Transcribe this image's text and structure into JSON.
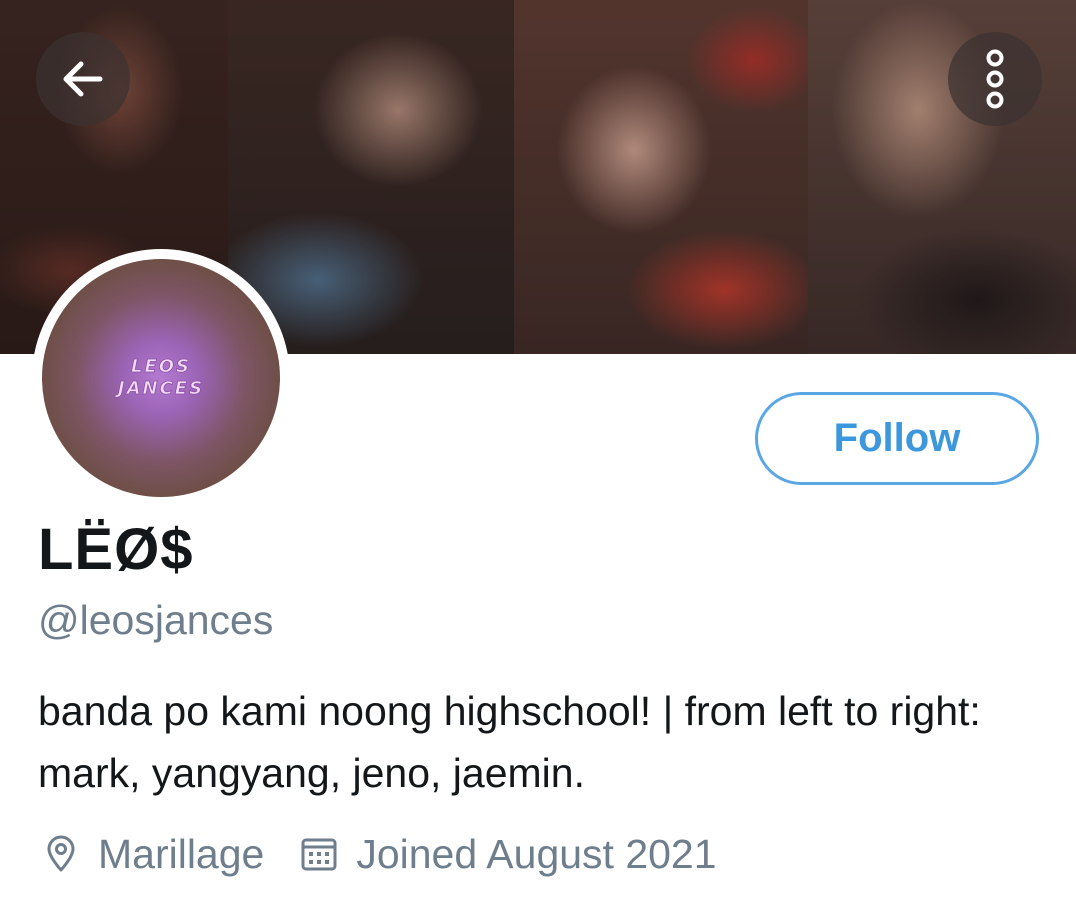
{
  "header": {
    "back_icon": "arrow-left-icon",
    "more_icon": "more-vertical-icon"
  },
  "profile": {
    "avatar_text_line1": "LEOS",
    "avatar_text_line2": "JANCES",
    "display_name": "LËØ$",
    "handle": "@leosjances",
    "bio": "banda po kami noong highschool! | from left to right: mark, yangyang, jeno, jaemin.",
    "location": "Marillage",
    "joined": "Joined August 2021"
  },
  "actions": {
    "follow_label": "Follow"
  },
  "colors": {
    "accent": "#3d97dd",
    "text_primary": "#14171a",
    "text_secondary": "#6f7e8c"
  }
}
